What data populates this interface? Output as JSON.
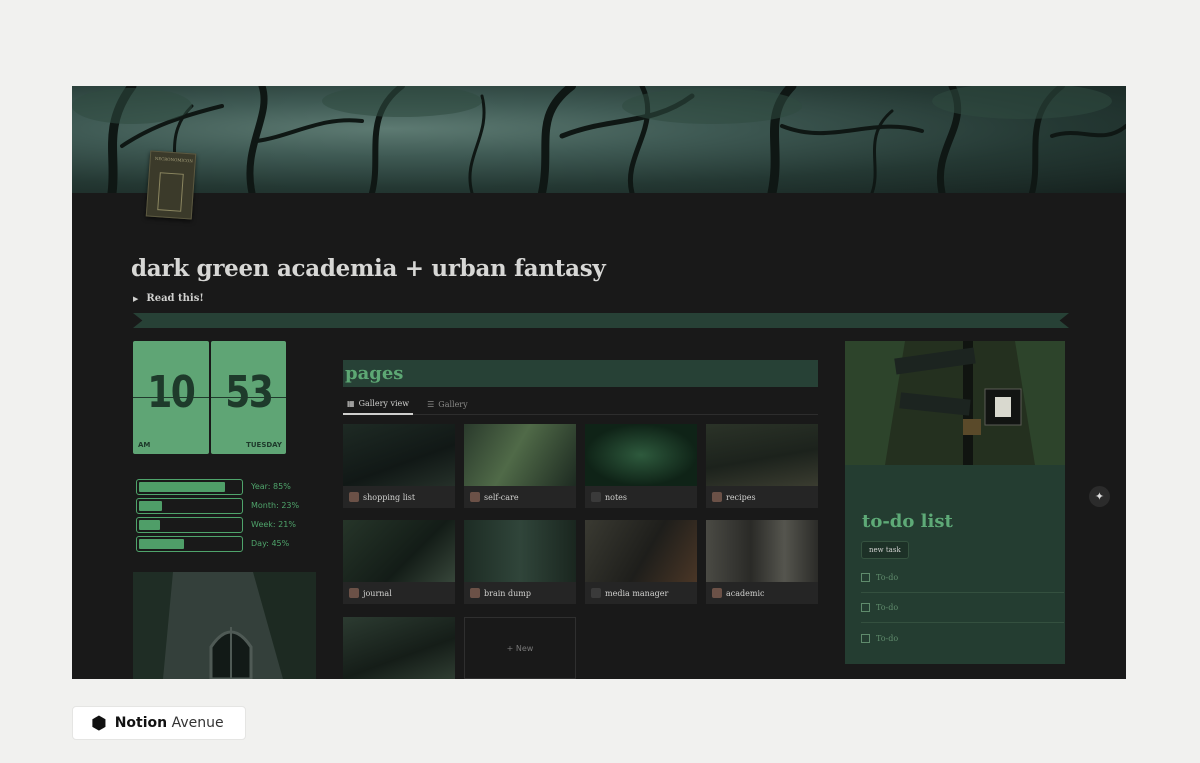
{
  "page": {
    "title": "dark green academia + urban fantasy",
    "toggle_label": "Read this!"
  },
  "clock": {
    "hour": "10",
    "minute": "53",
    "ampm": "AM",
    "day": "TUESDAY"
  },
  "progress": [
    {
      "label": "Year: 85%",
      "value": 0.85
    },
    {
      "label": "Month: 23%",
      "value": 0.23
    },
    {
      "label": "Week: 21%",
      "value": 0.21
    },
    {
      "label": "Day: 45%",
      "value": 0.45
    }
  ],
  "pages_section": {
    "heading": "pages",
    "tabs": [
      {
        "label": "Gallery view",
        "icon": "grid-icon",
        "active": true
      },
      {
        "label": "Gallery",
        "icon": "list-icon",
        "active": false
      }
    ],
    "cards": [
      {
        "label": "shopping list",
        "icon": "emoji-icon"
      },
      {
        "label": "self-care",
        "icon": "emoji-icon"
      },
      {
        "label": "notes",
        "icon": "blank-icon"
      },
      {
        "label": "recipes",
        "icon": "emoji-icon"
      },
      {
        "label": "journal",
        "icon": "emoji-icon"
      },
      {
        "label": "brain dump",
        "icon": "emoji-icon"
      },
      {
        "label": "media manager",
        "icon": "blank-icon"
      },
      {
        "label": "academic",
        "icon": "emoji-icon"
      }
    ],
    "new_label": "+ New"
  },
  "todo": {
    "heading": "to-do list",
    "new_task_label": "new task",
    "items": [
      "To-do",
      "To-do",
      "To-do"
    ]
  },
  "brand": {
    "name_bold": "Notion",
    "name_light": "Avenue"
  },
  "colors": {
    "accent": "#5fa575",
    "dark_green": "#274136",
    "background": "#191919"
  }
}
